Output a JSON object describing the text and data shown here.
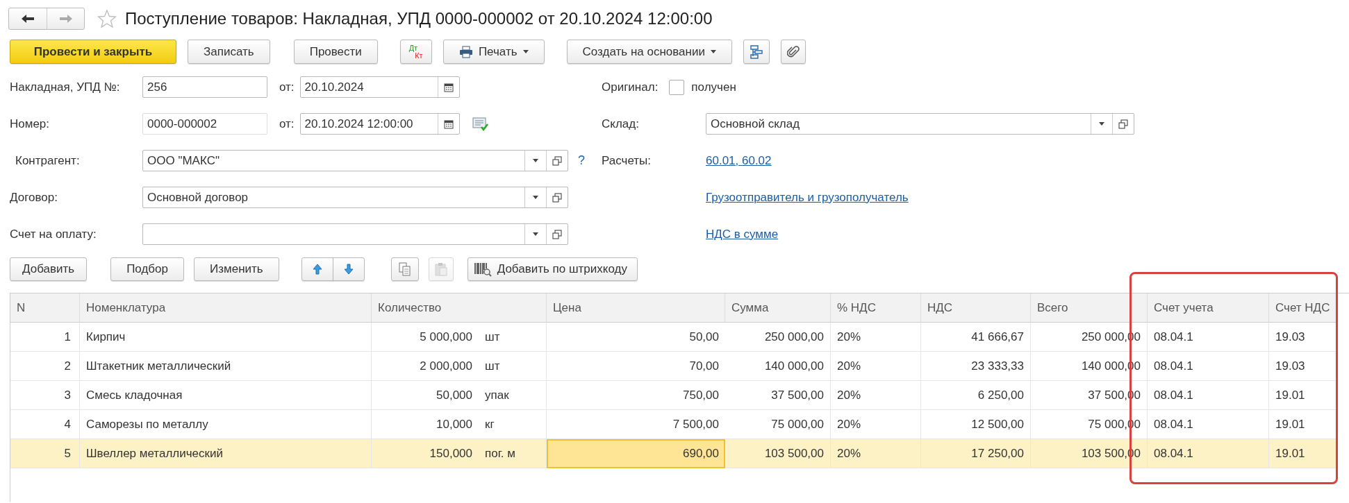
{
  "window": {
    "title": "Поступление товаров: Накладная, УПД 0000-000002 от 20.10.2024 12:00:00",
    "favorite": false
  },
  "toolbar": [
    {
      "kind": "primary",
      "label": "Провести и закрыть"
    },
    {
      "kind": "button",
      "label": "Записать"
    },
    {
      "kind": "button",
      "label": "Провести"
    },
    {
      "kind": "dtkt",
      "top": "Дт",
      "bottom": "Кт"
    },
    {
      "kind": "print",
      "label": "Печать"
    },
    {
      "kind": "menu",
      "label": "Создать на основании"
    },
    {
      "kind": "structure"
    },
    {
      "kind": "attach"
    }
  ],
  "left_fields": [
    {
      "kind": "number_date",
      "label": "Накладная, УПД №:",
      "value": "256",
      "date_label": "от:",
      "date": "20.10.2024",
      "posted": false
    },
    {
      "kind": "number_date",
      "label": "Номер:",
      "value": "0000-000002",
      "date_label": "от:",
      "date": "20.10.2024 12:00:00",
      "posted": true
    },
    {
      "kind": "select",
      "label": "Контрагент:",
      "value": "ООО \"МАКС\"",
      "help": "?"
    },
    {
      "kind": "select",
      "label": "Договор:",
      "value": "Основной договор"
    },
    {
      "kind": "select",
      "label": "Счет на оплату:"
    }
  ],
  "right_fields": [
    {
      "kind": "checkbox",
      "label": "Оригинал:",
      "text": "получен",
      "checked": false
    },
    {
      "kind": "select",
      "label": "Склад:",
      "value": "Основной склад"
    },
    {
      "kind": "link",
      "label": "Расчеты:",
      "text": "60.01, 60.02"
    },
    {
      "kind": "link",
      "text": "Грузоотправитель и грузополучатель"
    },
    {
      "kind": "link",
      "text": "НДС в сумме"
    }
  ],
  "table_toolbar": [
    {
      "kind": "button",
      "label": "Добавить",
      "disabled": false
    },
    {
      "kind": "button",
      "label": "Подбор",
      "disabled": false
    },
    {
      "kind": "button",
      "label": "Изменить",
      "disabled": false
    },
    {
      "kind": "up",
      "disabled": false
    },
    {
      "kind": "down",
      "disabled": false
    },
    {
      "kind": "copy",
      "disabled": false
    },
    {
      "kind": "paste",
      "disabled": true
    },
    {
      "kind": "barcode",
      "label": "Добавить по штрихкоду",
      "disabled": false
    }
  ],
  "table": {
    "columns": [
      "N",
      "Номенклатура",
      "Количество",
      "Цена",
      "Сумма",
      "% НДС",
      "НДС",
      "Всего",
      "Счет учета",
      "Счет НДС"
    ],
    "rows": [
      {
        "n": "1",
        "name": "Кирпич",
        "qty": "5 000,000",
        "unit": "шт",
        "price": "50,00",
        "sum": "250 000,00",
        "vat_rate": "20%",
        "vat": "41 666,67",
        "total": "250 000,00",
        "account": "08.04.1",
        "vat_account": "19.03",
        "selected": false,
        "price_active": false
      },
      {
        "n": "2",
        "name": "Штакетник металлический",
        "qty": "2 000,000",
        "unit": "шт",
        "price": "70,00",
        "sum": "140 000,00",
        "vat_rate": "20%",
        "vat": "23 333,33",
        "total": "140 000,00",
        "account": "08.04.1",
        "vat_account": "19.03",
        "selected": false,
        "price_active": false
      },
      {
        "n": "3",
        "name": "Смесь кладочная",
        "qty": "50,000",
        "unit": "упак",
        "price": "750,00",
        "sum": "37 500,00",
        "vat_rate": "20%",
        "vat": "6 250,00",
        "total": "37 500,00",
        "account": "08.04.1",
        "vat_account": "19.01",
        "selected": false,
        "price_active": false
      },
      {
        "n": "4",
        "name": "Саморезы по металлу",
        "qty": "10,000",
        "unit": "кг",
        "price": "7 500,00",
        "sum": "75 000,00",
        "vat_rate": "20%",
        "vat": "12 500,00",
        "total": "75 000,00",
        "account": "08.04.1",
        "vat_account": "19.01",
        "selected": false,
        "price_active": false
      },
      {
        "n": "5",
        "name": "Швеллер металлический",
        "qty": "150,000",
        "unit": "пог. м",
        "price": "690,00",
        "sum": "103 500,00",
        "vat_rate": "20%",
        "vat": "17 250,00",
        "total": "103 500,00",
        "account": "08.04.1",
        "vat_account": "19.01",
        "selected": true,
        "price_active": true
      }
    ]
  }
}
